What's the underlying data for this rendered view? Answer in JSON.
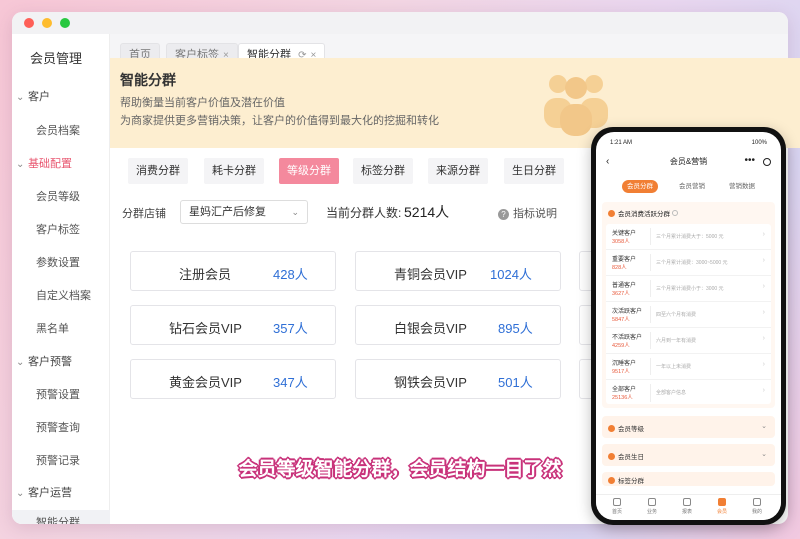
{
  "sidebar": {
    "app_title": "会员管理",
    "groups": [
      {
        "label": "客户",
        "items": [
          "会员档案"
        ]
      },
      {
        "label": "基础配置",
        "items": [
          "会员等级",
          "客户标签",
          "参数设置",
          "自定义档案",
          "黑名单"
        ]
      },
      {
        "label": "客户预警",
        "items": [
          "预警设置",
          "预警查询",
          "预警记录"
        ]
      },
      {
        "label": "客户运营",
        "items": [
          "智能分群"
        ]
      }
    ]
  },
  "tabs": [
    {
      "label": "首页"
    },
    {
      "label": "客户标签",
      "close": "×"
    },
    {
      "label": "智能分群",
      "close": "×"
    }
  ],
  "banner": {
    "title": "智能分群",
    "line1": "帮助衡量当前客户价值及潜在价值",
    "line2": "为商家提供更多营销决策，让客户的价值得到最大化的挖掘和转化"
  },
  "filters": [
    "消费分群",
    "耗卡分群",
    "等级分群",
    "标签分群",
    "来源分群",
    "生日分群"
  ],
  "store": {
    "label": "分群店铺",
    "value": "星妈汇产后修复",
    "count_label": "当前分群人数:",
    "count_value": "5214人",
    "info_link": "指标说明"
  },
  "cards": [
    {
      "name": "注册会员",
      "value": "428人"
    },
    {
      "name": "青铜会员VIP",
      "value": "1024人"
    },
    {
      "name": "钻石会员VIP",
      "value": "357人"
    },
    {
      "name": "白银会员VIP",
      "value": "895人"
    },
    {
      "name": "黄金会员VIP",
      "value": "347人"
    },
    {
      "name": "钢铁会员VIP",
      "value": "501人"
    }
  ],
  "caption": "会员等级智能分群，会员结构一目了然",
  "phone": {
    "time": "1:21 AM",
    "battery": "100%",
    "title": "会员&营销",
    "tabs": [
      "会员分群",
      "会员营销",
      "营销数据"
    ],
    "panel_title": "会员消费活跃分群",
    "rows": [
      {
        "name": "关键客户",
        "count": "3058人",
        "desc": "三个月累计消费大于：5000 元"
      },
      {
        "name": "重要客户",
        "count": "828人",
        "desc": "三个月累计消费：3000~5000 元"
      },
      {
        "name": "普通客户",
        "count": "3627人",
        "desc": "三个月累计消费小于：3000 元"
      },
      {
        "name": "次活跃客户",
        "count": "5847人",
        "desc": "四至六个月有消费"
      },
      {
        "name": "不活跃客户",
        "count": "4259人",
        "desc": "六月到一年有消费"
      },
      {
        "name": "沉睡客户",
        "count": "9517人",
        "desc": "一年以上未消费"
      },
      {
        "name": "全部客户",
        "count": "25136人",
        "desc": "全部客户信息"
      }
    ],
    "sections": [
      "会员等级",
      "会员生日",
      "标签分群"
    ],
    "nav": [
      "首页",
      "业务",
      "报表",
      "会员",
      "我的"
    ]
  }
}
